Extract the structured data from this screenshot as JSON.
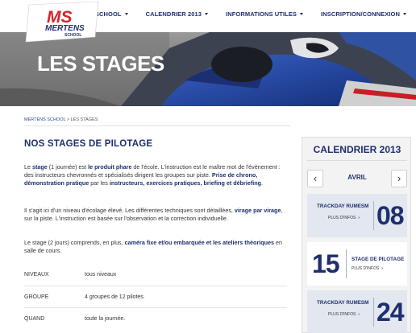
{
  "logo": {
    "brand": "MS",
    "name": "MERTENS",
    "sub": "SCHOOL"
  },
  "nav": [
    {
      "label": "LA MERTENS SCHOOL"
    },
    {
      "label": "CALENDRIER 2013"
    },
    {
      "label": "INFORMATIONS UTILES"
    },
    {
      "label": "INSCRIPTION/CONNEXION"
    }
  ],
  "hero": {
    "title": "LES STAGES"
  },
  "breadcrumb": {
    "home": "MERTENS SCHOOL",
    "sep": " > ",
    "current": "LES STAGES"
  },
  "main": {
    "title": "NOS STAGES DE PILOTAGE",
    "p1": {
      "t1": "Le ",
      "b1": "stage",
      "t2": " (1 journée) est ",
      "b2": "le produit phare",
      "t3": " de l'école. L'instruction est le maître mot de l'évènement : des instructeurs chevronnés et spécialisés dirigent les groupes sur piste. ",
      "b3": "Prise de chrono, démonstration pratique",
      "t4": " par les ",
      "b4": "instructeurs, exercices pratiques, briefing et débriefing",
      "t5": "."
    },
    "p2": {
      "t1": "Il s'agit ici d'un niveau d'écolage élevé. Les différentes techniques sont détaillées, ",
      "b1": "virage par virage",
      "t2": ", sur la piste. L'instruction est basée sur l'observation et la correction individuelle."
    },
    "p3": {
      "t1": "Le stage (2 jours) comprends, en plus, ",
      "b1": "caméra fixe et/ou embarquée et les ateliers théoriques",
      "t2": " en salle de cours."
    },
    "info": [
      {
        "key": "NIVEAUX",
        "value": "tous niveaux"
      },
      {
        "key": "GROUPE",
        "value": "4 groupes de 12 pilotes."
      },
      {
        "key": "QUAND",
        "value": "toute la journée."
      }
    ]
  },
  "calendar": {
    "title": "CALENDRIER",
    "year": "2013",
    "month": "AVRIL",
    "prev_icon": "chevron-left-icon",
    "next_icon": "chevron-right-icon",
    "events": [
      {
        "name": "TRACKDAY RUMESM",
        "info": "PLUS D'INFOS",
        "date": "08"
      },
      {
        "name": "STAGE DE PILOTAGE",
        "info": "PLUS D'INFOS",
        "date": "15"
      },
      {
        "name": "TRACKDAY RUMESM",
        "info": "PLUS D'INFOS",
        "date": "24"
      }
    ]
  },
  "colors": {
    "brand_navy": "#1e2f6e",
    "brand_red": "#d8232a",
    "event_bg": "#e2e7f0"
  }
}
